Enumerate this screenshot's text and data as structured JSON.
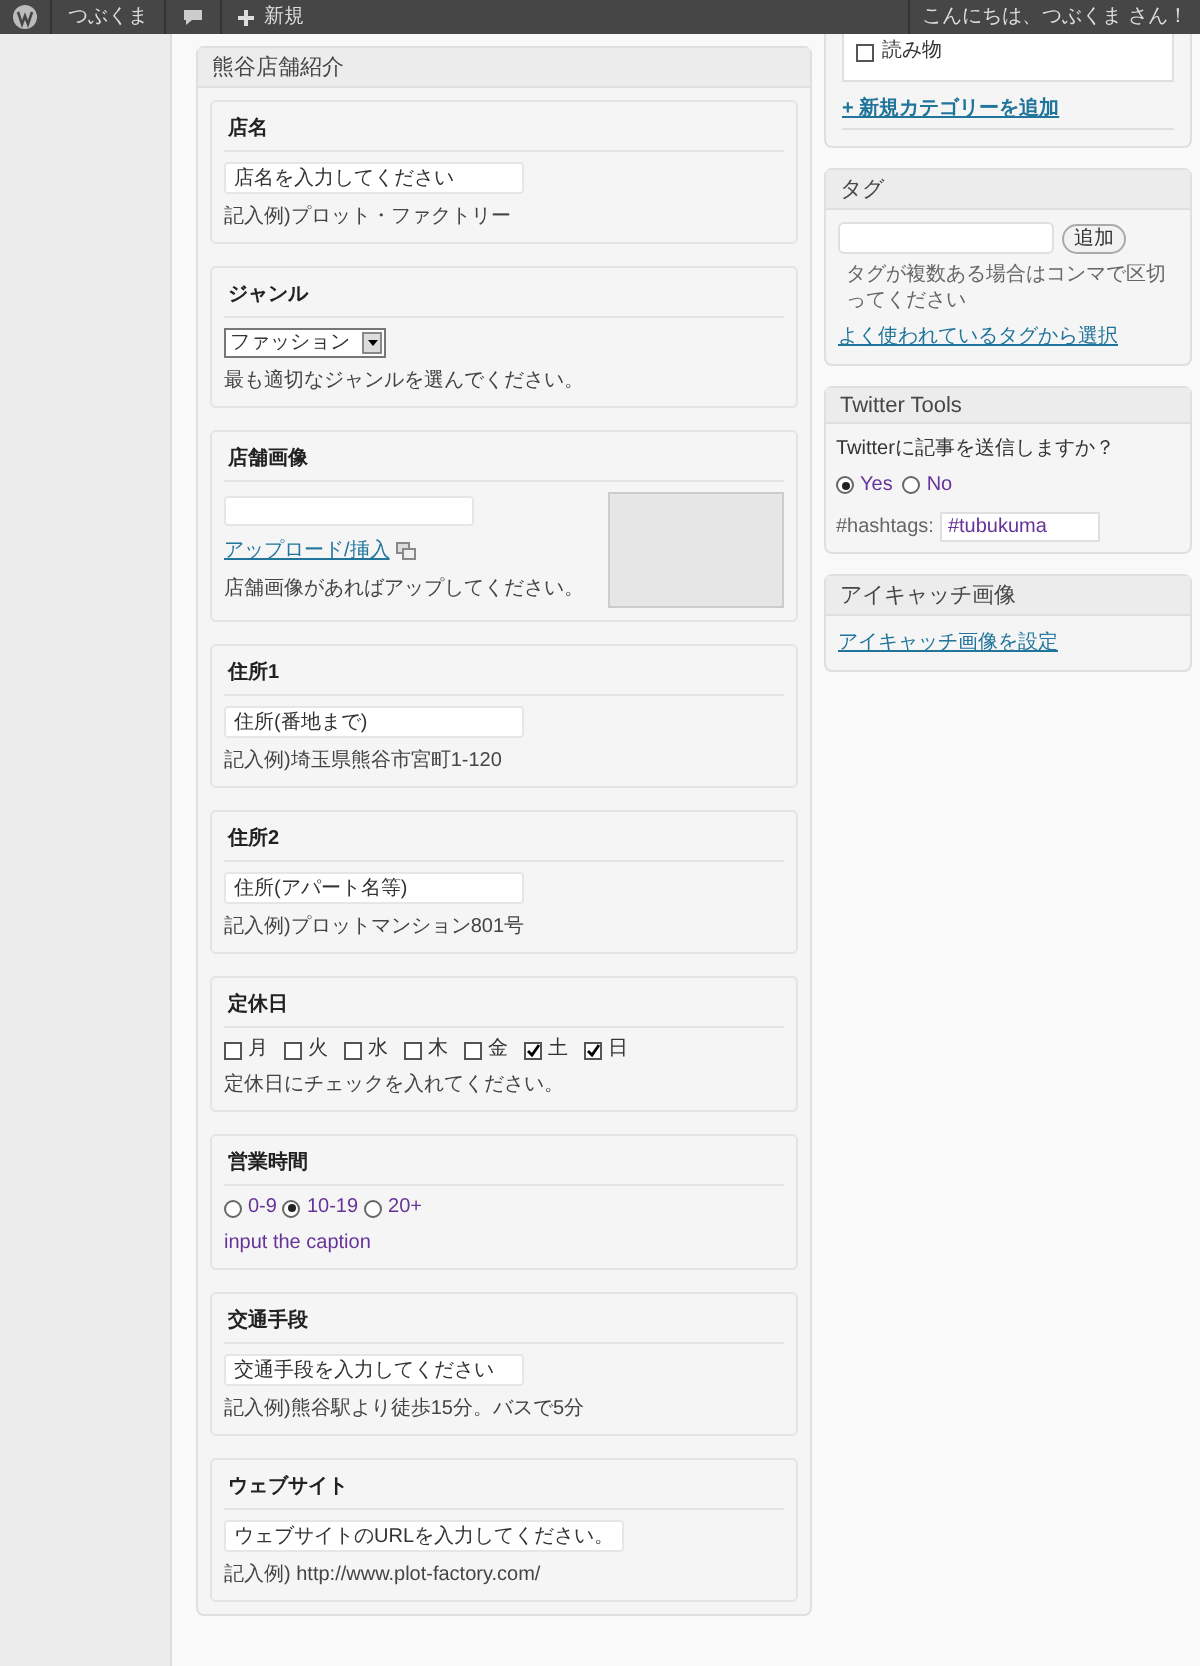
{
  "admin_bar": {
    "site": "つぶくま",
    "new": "新規",
    "greeting": "こんにちは、つぶくま さん！"
  },
  "main_box": {
    "title": "熊谷店舗紹介",
    "fields": [
      {
        "kind": "text",
        "label": "店名",
        "placeholder": "店名を入力してください",
        "description": "記入例)プロット・ファクトリー"
      },
      {
        "kind": "select",
        "label": "ジャンル",
        "value": "ファッション",
        "description": "最も適切なジャンルを選んでください。"
      },
      {
        "kind": "image",
        "label": "店舗画像",
        "link": "アップロード/挿入",
        "description": "店舗画像があればアップしてください。"
      },
      {
        "kind": "text",
        "label": "住所1",
        "placeholder": "住所(番地まで)",
        "description": "記入例)埼玉県熊谷市宮町1-120"
      },
      {
        "kind": "text",
        "label": "住所2",
        "placeholder": "住所(アパート名等)",
        "description": "記入例)プロットマンション801号"
      },
      {
        "kind": "checkboxes",
        "label": "定休日",
        "options": [
          {
            "label": "月",
            "checked": false
          },
          {
            "label": "火",
            "checked": false
          },
          {
            "label": "水",
            "checked": false
          },
          {
            "label": "木",
            "checked": false
          },
          {
            "label": "金",
            "checked": false
          },
          {
            "label": "土",
            "checked": true
          },
          {
            "label": "日",
            "checked": true
          }
        ],
        "description": "定休日にチェックを入れてください。"
      },
      {
        "kind": "radios",
        "label": "営業時間",
        "options": [
          {
            "label": "0-9",
            "selected": false
          },
          {
            "label": "10-19",
            "selected": true
          },
          {
            "label": "20+",
            "selected": false
          }
        ],
        "description": "input the caption"
      },
      {
        "kind": "text",
        "label": "交通手段",
        "placeholder": "交通手段を入力してください",
        "description": "記入例)熊谷駅より徒歩15分。バスで5分"
      },
      {
        "kind": "url",
        "label": "ウェブサイト",
        "placeholder": "ウェブサイトのURLを入力してください。",
        "description": "記入例) http://www.plot-factory.com/"
      }
    ]
  },
  "categories_box": {
    "items": [
      {
        "label": "読み物",
        "checked": false
      }
    ],
    "add_link": "+ 新規カテゴリーを追加"
  },
  "tags_box": {
    "title": "タグ",
    "button": "追加",
    "hint": "タグが複数ある場合はコンマで区切ってください",
    "link": "よく使われているタグから選択"
  },
  "twitter_box": {
    "title": "Twitter Tools",
    "question": "Twitterに記事を送信しますか？",
    "options": [
      {
        "label": "Yes",
        "selected": true
      },
      {
        "label": "No",
        "selected": false
      }
    ],
    "hashtags_label": "#hashtags:",
    "hashtags_value": "#tubukuma"
  },
  "featured_box": {
    "title": "アイキャッチ画像",
    "link": "アイキャッチ画像を設定"
  }
}
